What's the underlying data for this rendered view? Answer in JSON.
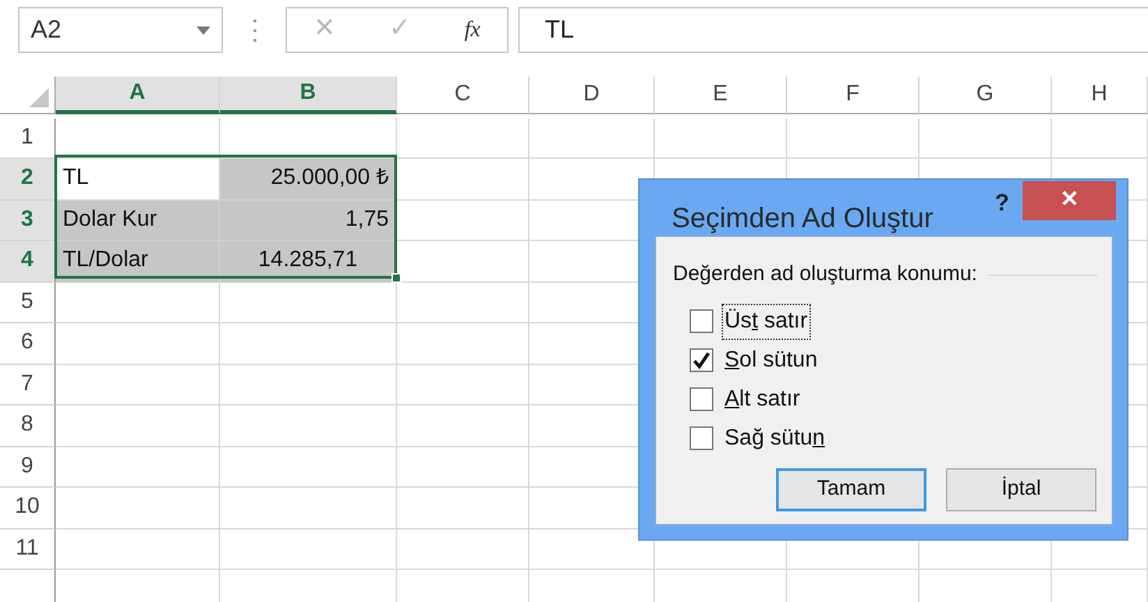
{
  "formula_bar": {
    "name_box": "A2",
    "cancel": "✕",
    "enter": "✓",
    "function": "fx",
    "content": "TL"
  },
  "columns": [
    {
      "label": "A",
      "selected": true
    },
    {
      "label": "B",
      "selected": true
    },
    {
      "label": "C",
      "selected": false
    },
    {
      "label": "D",
      "selected": false
    },
    {
      "label": "E",
      "selected": false
    },
    {
      "label": "F",
      "selected": false
    },
    {
      "label": "G",
      "selected": false
    },
    {
      "label": "H",
      "selected": false
    }
  ],
  "rows": [
    {
      "label": "1",
      "selected": false,
      "cells": []
    },
    {
      "label": "2",
      "selected": true,
      "cells": [
        {
          "text": "TL",
          "kind": "label",
          "selected": false
        },
        {
          "text": "25.000,00 ₺",
          "kind": "value",
          "selected": true
        }
      ]
    },
    {
      "label": "3",
      "selected": true,
      "cells": [
        {
          "text": "Dolar Kur",
          "kind": "label",
          "selected": true
        },
        {
          "text": "1,75",
          "kind": "value",
          "selected": true
        }
      ]
    },
    {
      "label": "4",
      "selected": true,
      "cells": [
        {
          "text": "TL/Dolar",
          "kind": "label",
          "selected": true
        },
        {
          "text": "14.285,71",
          "kind": "result",
          "selected": true
        }
      ]
    },
    {
      "label": "5",
      "selected": false,
      "cells": []
    },
    {
      "label": "6",
      "selected": false,
      "cells": []
    },
    {
      "label": "7",
      "selected": false,
      "cells": []
    },
    {
      "label": "8",
      "selected": false,
      "cells": []
    },
    {
      "label": "9",
      "selected": false,
      "cells": []
    },
    {
      "label": "10",
      "selected": false,
      "cells": []
    },
    {
      "label": "11",
      "selected": false,
      "cells": []
    }
  ],
  "dialog": {
    "title": "Seçimden Ad Oluştur",
    "help": "?",
    "close": "✕",
    "group_label": "Değerden ad oluşturma konumu:",
    "options": [
      {
        "label": {
          "before": "Üs",
          "key": "t",
          "after": " satır"
        },
        "checked": false,
        "focused": true
      },
      {
        "label": {
          "key": "S",
          "after": "ol sütun"
        },
        "checked": true,
        "focused": false
      },
      {
        "label": {
          "key": "A",
          "after": "lt satır"
        },
        "checked": false,
        "focused": false
      },
      {
        "label": {
          "before": "Sağ sütu",
          "key": "n"
        },
        "checked": false,
        "focused": false
      }
    ],
    "buttons": [
      {
        "label": "Tamam",
        "default": true
      },
      {
        "label": "İptal",
        "default": false
      }
    ]
  }
}
